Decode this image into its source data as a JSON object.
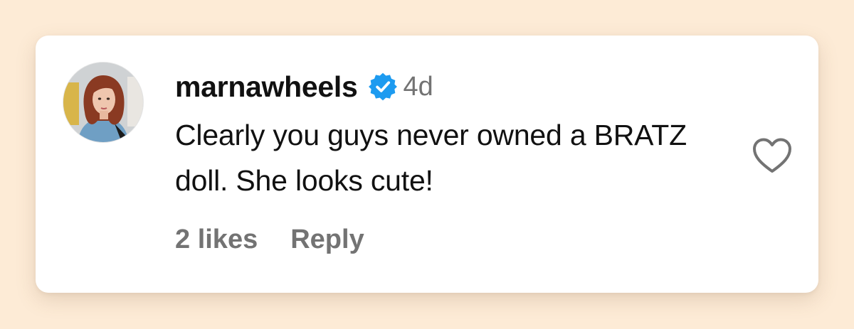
{
  "comment": {
    "username": "marnawheels",
    "verified": true,
    "time": "4d",
    "text": "Clearly you guys never owned a BRATZ doll. She looks cute!",
    "likes_label": "2 likes",
    "reply_label": "Reply"
  },
  "colors": {
    "page_background": "#fdebd6",
    "card_background": "#ffffff",
    "verified_badge": "#1d9bf0",
    "primary_text": "#111111",
    "secondary_text": "#737373",
    "heart_stroke": "#737373"
  },
  "icons": {
    "verified": "verified-badge-icon",
    "like": "heart-outline-icon"
  }
}
